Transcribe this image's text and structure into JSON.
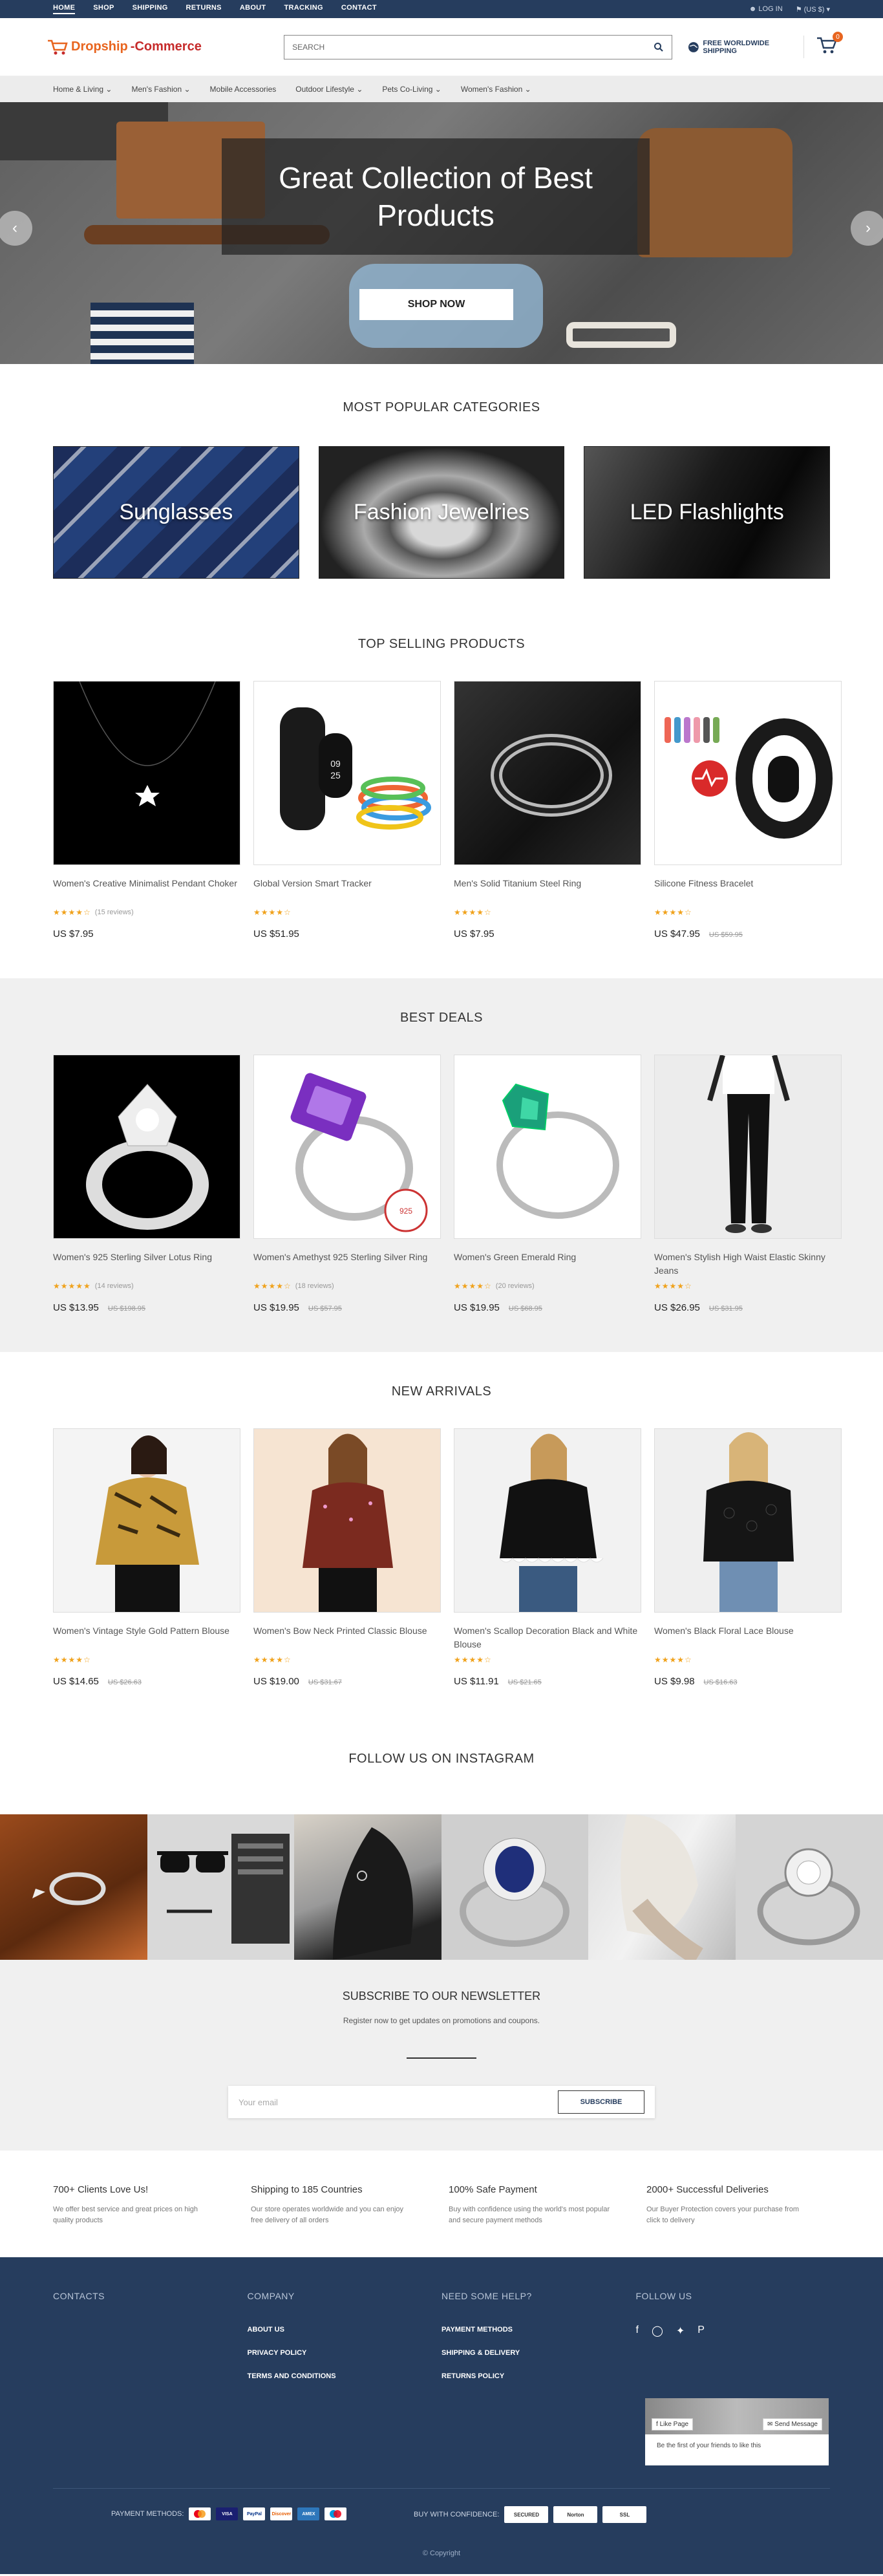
{
  "topbar": {
    "nav": [
      "HOME",
      "SHOP",
      "SHIPPING",
      "RETURNS",
      "ABOUT",
      "TRACKING",
      "CONTACT"
    ],
    "login": "LOG IN",
    "currency": "(US $)"
  },
  "header": {
    "logo_part1": "Dropship",
    "logo_part2": "-Commerce",
    "search_placeholder": "SEARCH",
    "shipping_text": "FREE WORLDWIDE SHIPPING",
    "cart_count": "0"
  },
  "category_nav": [
    "Home & Living",
    "Men's Fashion",
    "Mobile Accessories",
    "Outdoor Lifestyle",
    "Pets Co-Living",
    "Women's Fashion"
  ],
  "hero": {
    "title": "Great Collection of Best Products",
    "button": "SHOP NOW",
    "prev": "‹",
    "next": "›"
  },
  "popular": {
    "title": "MOST POPULAR CATEGORIES",
    "items": [
      "Sunglasses",
      "Fashion Jewelries",
      "LED Flashlights"
    ]
  },
  "top_selling": {
    "title": "TOP SELLING PRODUCTS",
    "items": [
      {
        "name": "Women's Creative Minimalist Pendant Choker",
        "reviews": "(15 reviews)",
        "price": "US $7.95",
        "old": ""
      },
      {
        "name": "Global Version Smart Tracker",
        "reviews": "",
        "price": "US $51.95",
        "old": ""
      },
      {
        "name": "Men's Solid Titanium Steel Ring",
        "reviews": "",
        "price": "US $7.95",
        "old": ""
      },
      {
        "name": "Silicone Fitness Bracelet",
        "reviews": "",
        "price": "US $47.95",
        "old": "US $59.95"
      }
    ]
  },
  "best_deals": {
    "title": "BEST DEALS",
    "items": [
      {
        "name": "Women's 925 Sterling Silver Lotus Ring",
        "reviews": "(14 reviews)",
        "price": "US $13.95",
        "old": "US $198.95"
      },
      {
        "name": "Women's Amethyst 925 Sterling Silver Ring",
        "reviews": "(18 reviews)",
        "price": "US $19.95",
        "old": "US $57.95"
      },
      {
        "name": "Women's Green Emerald Ring",
        "reviews": "(20 reviews)",
        "price": "US $19.95",
        "old": "US $68.95"
      },
      {
        "name": "Women's Stylish High Waist Elastic Skinny Jeans",
        "reviews": "",
        "price": "US $26.95",
        "old": "US $31.95"
      }
    ]
  },
  "new_arrivals": {
    "title": "NEW ARRIVALS",
    "items": [
      {
        "name": "Women's Vintage Style Gold Pattern Blouse",
        "reviews": "",
        "price": "US $14.65",
        "old": "US $26.63"
      },
      {
        "name": "Women's Bow Neck Printed Classic Blouse",
        "reviews": "",
        "price": "US $19.00",
        "old": "US $31.67"
      },
      {
        "name": "Women's Scallop Decoration Black and White Blouse",
        "reviews": "",
        "price": "US $11.91",
        "old": "US $21.65"
      },
      {
        "name": "Women's Black Floral Lace Blouse",
        "reviews": "",
        "price": "US $9.98",
        "old": "US $16.63"
      }
    ]
  },
  "instagram": {
    "title": "FOLLOW US ON INSTAGRAM"
  },
  "newsletter": {
    "title": "SUBSCRIBE TO OUR NEWSLETTER",
    "text": "Register now to get updates on promotions and coupons.",
    "placeholder": "Your email",
    "button": "SUBSCRIBE"
  },
  "features": [
    {
      "title": "700+ Clients Love Us!",
      "text": "We offer best service and great prices on high quality products"
    },
    {
      "title": "Shipping to 185 Countries",
      "text": "Our store operates worldwide and you can enjoy free delivery of all orders"
    },
    {
      "title": "100% Safe Payment",
      "text": "Buy with confidence using the world's most popular and secure payment methods"
    },
    {
      "title": "2000+ Successful Deliveries",
      "text": "Our Buyer Protection covers your purchase from click to delivery"
    }
  ],
  "footer": {
    "contacts": "CONTACTS",
    "company": "COMPANY",
    "company_links": [
      "ABOUT US",
      "PRIVACY POLICY",
      "TERMS AND CONDITIONS"
    ],
    "help": "NEED SOME HELP?",
    "help_links": [
      "PAYMENT METHODS",
      "SHIPPING & DELIVERY",
      "RETURNS POLICY"
    ],
    "follow": "FOLLOW US",
    "fb_like": "Like Page",
    "fb_message": "Send Message",
    "fb_text": "Be the first of your friends to like this",
    "payment_label": "PAYMENT METHODS:",
    "payment_icons": [
      "mastercard",
      "VISA",
      "PayPal",
      "Discover",
      "AMEX",
      "maestro"
    ],
    "confidence_label": "BUY WITH CONFIDENCE:",
    "badges": [
      "SECURED",
      "Norton",
      "SSL"
    ],
    "copyright": "© Copyright"
  },
  "colors": {
    "navy": "#263d5e",
    "orange": "#e8651f",
    "red": "#c62b2b",
    "star": "#f0a21c"
  }
}
